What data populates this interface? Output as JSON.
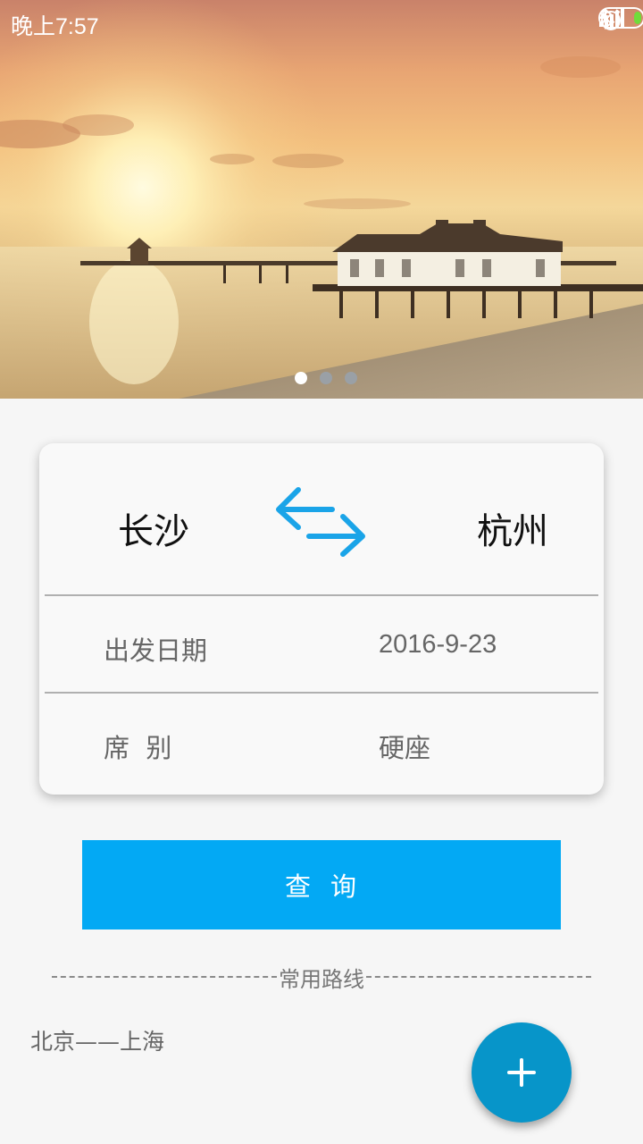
{
  "status_bar": {
    "time": "晚上7:57",
    "icons": [
      "bluetooth-icon",
      "alarm-icon",
      "signal-icon",
      "charging-icon",
      "battery-icon"
    ]
  },
  "banner": {
    "pager_count": 3,
    "active_index": 0
  },
  "ticket_form": {
    "from_city": "长沙",
    "to_city": "杭州",
    "swap_icon": "swap-arrows-icon",
    "date_label": "出发日期",
    "date_value": "2016-9-23",
    "seat_label": "席  别",
    "seat_value": "硬座"
  },
  "actions": {
    "query_label": "查  询"
  },
  "frequent_routes": {
    "header": "常用路线",
    "items": [
      "北京——上海"
    ]
  },
  "fab": {
    "icon": "plus-icon"
  },
  "colors": {
    "accent": "#03a9f4",
    "fab": "#0795c9",
    "swap_arrows": "#1aa4e8"
  }
}
